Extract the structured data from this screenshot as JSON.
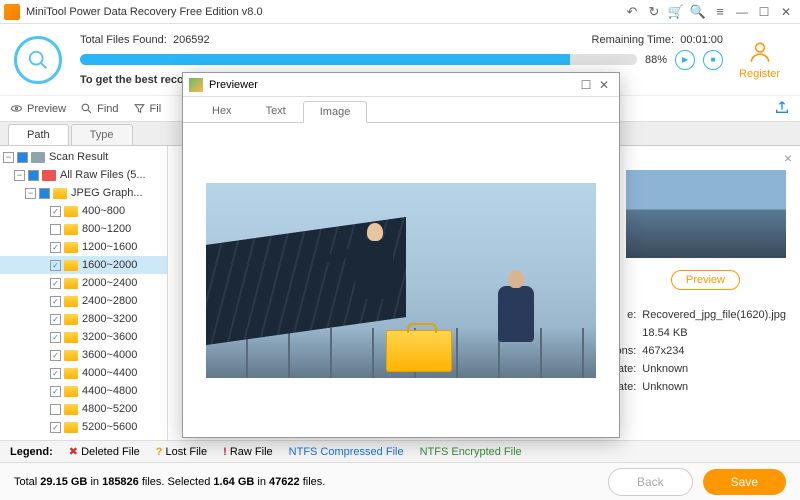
{
  "titlebar": {
    "text": "MiniTool Power Data Recovery Free Edition v8.0"
  },
  "scan": {
    "found_label": "Total Files Found:",
    "found_value": "206592",
    "remaining_label": "Remaining Time:",
    "remaining_value": "00:01:00",
    "percent": "88%",
    "message": "To get the best recov"
  },
  "register": {
    "label": "Register"
  },
  "toolbar": {
    "preview": "Preview",
    "find": "Find",
    "filter": "Fil"
  },
  "tabs": {
    "path": "Path",
    "type": "Type"
  },
  "tree": {
    "root": "Scan Result",
    "raw": "All Raw Files (5...",
    "jpeg": "JPEG Graph...",
    "ranges": [
      "400~800",
      "800~1200",
      "1200~1600",
      "1600~2000",
      "2000~2400",
      "2400~2800",
      "2800~3200",
      "3200~3600",
      "3600~4000",
      "4000~4400",
      "4400~4800",
      "4800~5200",
      "5200~5600"
    ]
  },
  "preview_btn": "Preview",
  "details": {
    "name_lbl": "e:",
    "name_val": "Recovered_jpg_file(1620).jpg",
    "size_val": "18.54 KB",
    "dim_lbl": "ons:",
    "dim_val": "467x234",
    "cdate_lbl": "Date:",
    "cdate_val": "Unknown",
    "mdate_lbl": "Date:",
    "mdate_val": "Unknown"
  },
  "legend": {
    "label": "Legend:",
    "deleted": "Deleted File",
    "lost": "Lost File",
    "raw": "Raw File",
    "ntfs_c": "NTFS Compressed File",
    "ntfs_e": "NTFS Encrypted File"
  },
  "footer": {
    "text_a": "Total ",
    "total_size": "29.15 GB",
    "text_b": " in ",
    "total_files": "185826",
    "text_c": " files.   Selected ",
    "sel_size": "1.64 GB",
    "sel_files": "47622",
    "text_d": " files.",
    "back": "Back",
    "save": "Save"
  },
  "previewer": {
    "title": "Previewer",
    "tabs": {
      "hex": "Hex",
      "text": "Text",
      "image": "Image"
    }
  }
}
